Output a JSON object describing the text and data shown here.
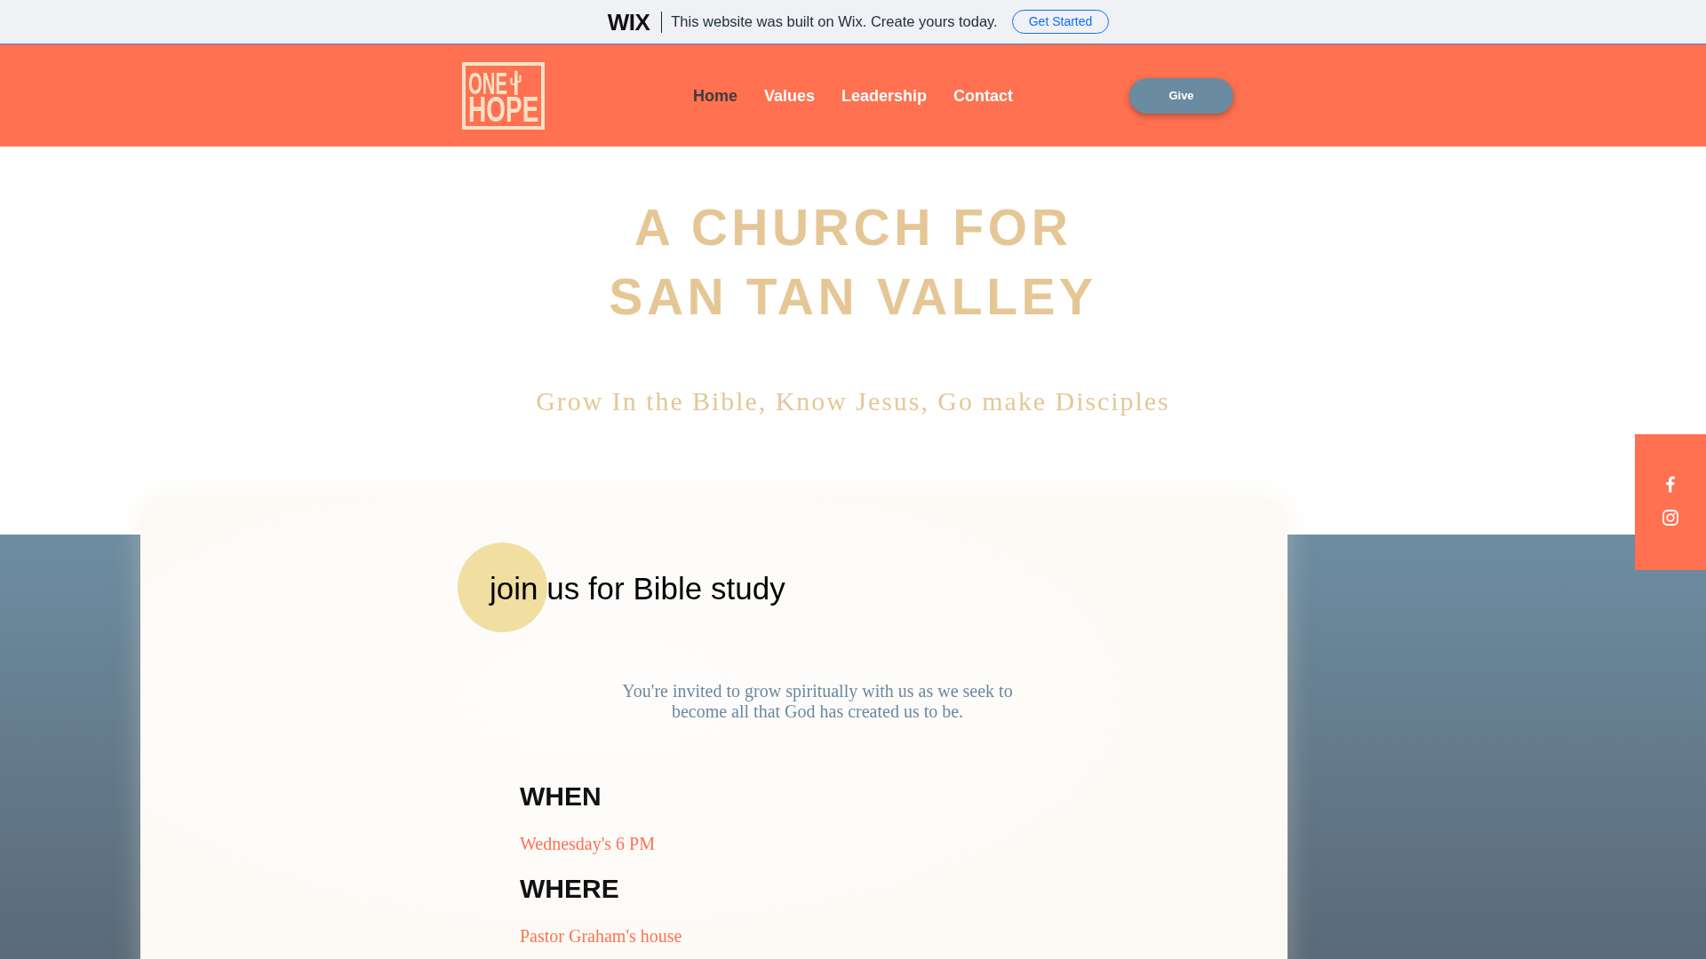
{
  "wix_banner": {
    "logo": "WIX",
    "message": "This website was built on Wix. Create yours today.",
    "button": "Get Started"
  },
  "header": {
    "logo": {
      "line_1": "ONE",
      "line_2": "HOPE"
    },
    "nav": [
      {
        "label": "Home",
        "selected": true
      },
      {
        "label": "Values",
        "selected": false
      },
      {
        "label": "Leadership",
        "selected": false
      },
      {
        "label": "Contact",
        "selected": false
      }
    ],
    "button": "Give"
  },
  "hero": {
    "title": "A CHURCH FOR SAN TAN VALLEY",
    "tagline": "Grow In the Bible, Know Jesus, Go make Disciples"
  },
  "bible_study": {
    "heading": "join us for Bible study",
    "intro": "You're invited to grow spiritually with us as we seek to become all that God has created us to be.",
    "details": [
      {
        "label": "WHEN",
        "value": "Wednesday's 6 PM"
      },
      {
        "label": "WHERE",
        "value": "Pastor Graham's house"
      }
    ]
  }
}
